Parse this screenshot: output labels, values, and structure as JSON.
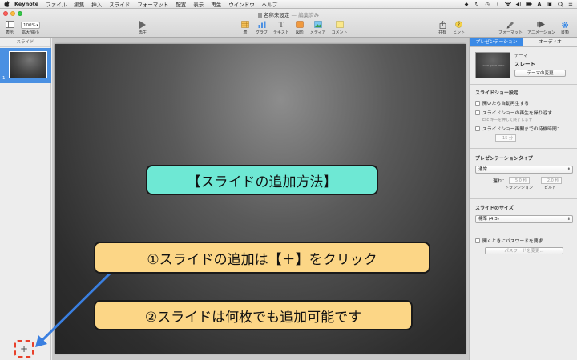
{
  "menubar": {
    "app_name": "Keynote",
    "items": [
      "ファイル",
      "編集",
      "挿入",
      "スライド",
      "フォーマット",
      "配置",
      "表示",
      "再生",
      "ウインドウ",
      "ヘルプ"
    ]
  },
  "window": {
    "title": "名称未設定",
    "title_status": "— 編集済み"
  },
  "toolbar": {
    "view_label": "表示",
    "zoom_value": "100%",
    "zoom_label": "拡大/縮小",
    "play_label": "再生",
    "table_label": "表",
    "chart_label": "グラフ",
    "text_label": "テキスト",
    "shape_label": "図形",
    "media_label": "メディア",
    "comment_label": "コメント",
    "share_label": "共有",
    "hint_label": "ヒント",
    "format_label": "フォーマット",
    "animate_label": "アニメーション",
    "document_label": "書類"
  },
  "navigator": {
    "header": "スライド",
    "slides": [
      {
        "number": "1"
      }
    ],
    "add_button": "+"
  },
  "slide": {
    "callout_title": "【スライドの追加方法】",
    "callout_step1": "①スライドの追加は【＋】をクリック",
    "callout_step2": "②スライドは何枚でも追加可能です"
  },
  "inspector": {
    "tab_presentation": "プレゼンテーション",
    "tab_audio": "オーディオ",
    "theme_label": "テーマ",
    "theme_name": "スレート",
    "theme_change_button": "テーマの変更",
    "theme_thumb_text": "Lorem Ipsum Dolor",
    "slideshow_section": "スライドショー設定",
    "autoplay_label": "開いたら自動再生する",
    "loop_label": "スライドショーの再生を繰り返す",
    "loop_hint": "Esc キーを押して終了します",
    "restart_label": "スライドショー再開までの待機時間：",
    "restart_value": "15 分",
    "presentation_type_section": "プレゼンテーションタイプ",
    "presentation_type_value": "通常",
    "delay_label": "遅れ：",
    "transition_value": "5.0 秒",
    "transition_label": "トランジション",
    "build_value": "2.0 秒",
    "build_label": "ビルド",
    "slide_size_section": "スライドのサイズ",
    "slide_size_value": "標準 (4:3)",
    "password_label": "開くときにパスワードを要求",
    "password_button": "パスワードを変更..."
  },
  "colors": {
    "accent_blue": "#3b8ae6",
    "callout_teal": "#6ee8d4",
    "callout_yellow": "#fcd686",
    "arrow_blue": "#3a7fe0",
    "highlight_red": "#e8402a"
  }
}
